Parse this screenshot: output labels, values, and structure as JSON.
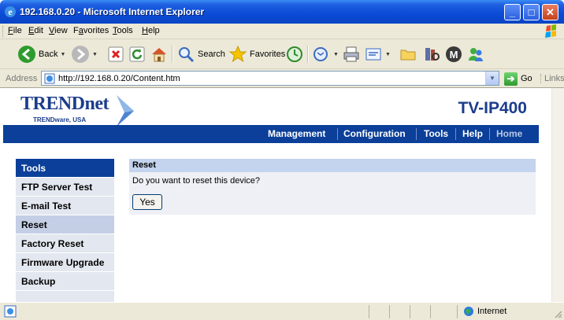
{
  "window": {
    "title": "192.168.0.20 - Microsoft Internet Explorer",
    "minimize_glyph": "_",
    "maximize_glyph": "□",
    "close_glyph": "✕"
  },
  "menu": {
    "items": [
      {
        "label": "File",
        "key": "F"
      },
      {
        "label": "Edit",
        "key": "E"
      },
      {
        "label": "View",
        "key": "V"
      },
      {
        "label": "Favorites",
        "key": "a"
      },
      {
        "label": "Tools",
        "key": "T"
      },
      {
        "label": "Help",
        "key": "H"
      }
    ]
  },
  "toolbar": {
    "back_label": "Back",
    "search_label": "Search",
    "favorites_label": "Favorites"
  },
  "address": {
    "label": "Address",
    "url": "http://192.168.0.20/Content.htm",
    "go_label": "Go",
    "links_label": "Links"
  },
  "page": {
    "brand": "TRENDnet",
    "brand_sub": "TRENDware, USA",
    "model": "TV-IP400",
    "nav": [
      "Management",
      "Configuration",
      "Tools",
      "Help",
      "Home"
    ],
    "sidebar": {
      "header": "Tools",
      "items": [
        "FTP Server Test",
        "E-mail Test",
        "Reset",
        "Factory Reset",
        "Firmware Upgrade",
        "Backup"
      ],
      "active": "Reset"
    },
    "panel": {
      "title": "Reset",
      "question": "Do you want to reset this device?",
      "yes_label": "Yes"
    }
  },
  "status": {
    "zone_label": "Internet"
  },
  "colors": {
    "brand_blue": "#1c3d8c",
    "nav_blue": "#0b3f99",
    "panel_header": "#c4d3ee",
    "panel_body": "#eef0f5",
    "sidebar_bg": "#e3e7ef",
    "sidebar_active": "#c4cfe6"
  }
}
